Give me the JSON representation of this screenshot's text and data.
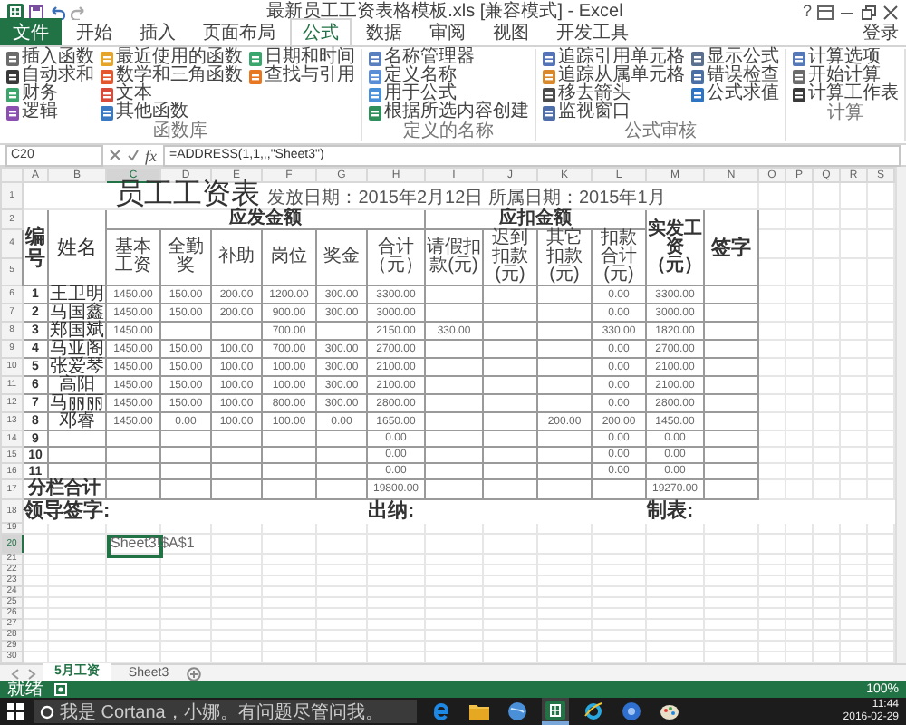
{
  "window": {
    "title": "最新员工工资表格模板.xls [兼容模式] - Excel",
    "help": "?",
    "sign_in": "登录"
  },
  "ribbon_tabs": [
    {
      "label": "文件",
      "kind": "file",
      "selected": false
    },
    {
      "label": "开始",
      "kind": "tab",
      "selected": false
    },
    {
      "label": "插入",
      "kind": "tab",
      "selected": false
    },
    {
      "label": "页面布局",
      "kind": "tab",
      "selected": false
    },
    {
      "label": "公式",
      "kind": "tab",
      "selected": true
    },
    {
      "label": "数据",
      "kind": "tab",
      "selected": false
    },
    {
      "label": "审阅",
      "kind": "tab",
      "selected": false
    },
    {
      "label": "视图",
      "kind": "tab",
      "selected": false
    },
    {
      "label": "开发工具",
      "kind": "tab",
      "selected": false
    }
  ],
  "ribbon_groups": [
    {
      "label": "函数库",
      "columns": [
        [
          "插入函数",
          "自动求和",
          "财务",
          "逻辑"
        ],
        [
          "最近使用的函数",
          "数学和三角函数",
          "文本",
          "其他函数"
        ],
        [
          "日期和时间",
          "查找与引用"
        ]
      ]
    },
    {
      "label": "定义的名称",
      "columns": [
        [
          "名称管理器",
          "定义名称",
          "用于公式",
          "根据所选内容创建"
        ]
      ]
    },
    {
      "label": "公式审核",
      "columns": [
        [
          "追踪引用单元格",
          "追踪从属单元格",
          "移去箭头",
          "监视窗口"
        ],
        [
          "显示公式",
          "错误检查",
          "公式求值"
        ]
      ]
    },
    {
      "label": "计算",
      "columns": [
        [
          "计算选项",
          "开始计算",
          "计算工作表"
        ]
      ]
    }
  ],
  "formula_bar": {
    "name_box": "C20",
    "fx": "fx",
    "formula": "=ADDRESS(1,1,,,\"Sheet3\")"
  },
  "column_headers": [
    {
      "label": "A",
      "selected": false
    },
    {
      "label": "B",
      "selected": false
    },
    {
      "label": "C",
      "selected": true
    },
    {
      "label": "D",
      "selected": false
    },
    {
      "label": "E",
      "selected": false
    },
    {
      "label": "F",
      "selected": false
    },
    {
      "label": "G",
      "selected": false
    },
    {
      "label": "H",
      "selected": false
    },
    {
      "label": "I",
      "selected": false
    },
    {
      "label": "J",
      "selected": false
    },
    {
      "label": "K",
      "selected": false
    },
    {
      "label": "L",
      "selected": false
    },
    {
      "label": "M",
      "selected": false
    },
    {
      "label": "N",
      "selected": false
    },
    {
      "label": "O",
      "selected": false
    },
    {
      "label": "P",
      "selected": false
    },
    {
      "label": "Q",
      "selected": false
    },
    {
      "label": "R",
      "selected": false
    },
    {
      "label": "S",
      "selected": false
    }
  ],
  "row_headers": [
    {
      "label": "1",
      "selected": false
    },
    {
      "label": "2",
      "selected": false
    },
    {
      "label": "4",
      "selected": false
    },
    {
      "label": "5",
      "selected": false
    },
    {
      "label": "6",
      "selected": false
    },
    {
      "label": "7",
      "selected": false
    },
    {
      "label": "8",
      "selected": false
    },
    {
      "label": "9",
      "selected": false
    },
    {
      "label": "10",
      "selected": false
    },
    {
      "label": "11",
      "selected": false
    },
    {
      "label": "12",
      "selected": false
    },
    {
      "label": "13",
      "selected": false
    },
    {
      "label": "14",
      "selected": false
    },
    {
      "label": "15",
      "selected": false
    },
    {
      "label": "16",
      "selected": false
    },
    {
      "label": "17",
      "selected": false
    },
    {
      "label": "18",
      "selected": false
    },
    {
      "label": "19",
      "selected": false
    },
    {
      "label": "20",
      "selected": true
    },
    {
      "label": "21",
      "selected": false
    },
    {
      "label": "22",
      "selected": false
    },
    {
      "label": "23",
      "selected": false
    },
    {
      "label": "24",
      "selected": false
    },
    {
      "label": "25",
      "selected": false
    },
    {
      "label": "26",
      "selected": false
    },
    {
      "label": "27",
      "selected": false
    },
    {
      "label": "28",
      "selected": false
    },
    {
      "label": "29",
      "selected": false
    },
    {
      "label": "30",
      "selected": false
    }
  ],
  "sheet": {
    "title": "员工工资表",
    "date_info": "发放日期：2015年2月12日 所属日期：2015年1月",
    "header": {
      "number": "编号",
      "name": "姓名",
      "gross_group": "应发金额",
      "gross_columns": [
        "基本工资",
        "全勤奖",
        "补助",
        "岗位",
        "奖金",
        "合计（元）"
      ],
      "deduction_group": "应扣金额",
      "deduction_columns": [
        "请假扣款(元)",
        "迟到扣款(元)",
        "其它扣款(元)",
        "扣款合计(元)"
      ],
      "net": "实发工资（元）",
      "signature": "签字"
    },
    "employees": [
      {
        "no": "1",
        "name": "王卫明",
        "base": "1450.00",
        "attendance": "150.00",
        "allowance": "200.00",
        "post": "1200.00",
        "bonus": "300.00",
        "gross": "3300.00",
        "deduction": "0.00",
        "net": "3300.00"
      },
      {
        "no": "2",
        "name": "马国鑫",
        "base": "1450.00",
        "attendance": "150.00",
        "allowance": "200.00",
        "post": "900.00",
        "bonus": "300.00",
        "gross": "3000.00",
        "deduction": "0.00",
        "net": "3000.00"
      },
      {
        "no": "3",
        "name": "郑国斌",
        "base": "1450.00",
        "post": "700.00",
        "gross": "2150.00",
        "leave": "330.00",
        "deduction": "330.00",
        "net": "1820.00"
      },
      {
        "no": "4",
        "name": "马亚阁",
        "base": "1450.00",
        "attendance": "150.00",
        "allowance": "100.00",
        "post": "700.00",
        "bonus": "300.00",
        "gross": "2700.00",
        "deduction": "0.00",
        "net": "2700.00"
      },
      {
        "no": "5",
        "name": "张爱琴",
        "base": "1450.00",
        "attendance": "150.00",
        "allowance": "100.00",
        "post": "100.00",
        "bonus": "300.00",
        "gross": "2100.00",
        "deduction": "0.00",
        "net": "2100.00"
      },
      {
        "no": "6",
        "name": "高阳",
        "base": "1450.00",
        "attendance": "150.00",
        "allowance": "100.00",
        "post": "100.00",
        "bonus": "300.00",
        "gross": "2100.00",
        "deduction": "0.00",
        "net": "2100.00"
      },
      {
        "no": "7",
        "name": "马丽丽",
        "base": "1450.00",
        "attendance": "150.00",
        "allowance": "100.00",
        "post": "800.00",
        "bonus": "300.00",
        "gross": "2800.00",
        "deduction": "0.00",
        "net": "2800.00"
      },
      {
        "no": "8",
        "name": "邓睿",
        "base": "1450.00",
        "attendance": "0.00",
        "allowance": "100.00",
        "post": "100.00",
        "bonus": "0.00",
        "gross": "1650.00",
        "other": "200.00",
        "deduction": "200.00",
        "net": "1450.00"
      },
      {
        "no": "9",
        "gross": "0.00",
        "deduction": "0.00",
        "net": "0.00"
      },
      {
        "no": "10",
        "gross": "0.00",
        "deduction": "0.00",
        "net": "0.00"
      },
      {
        "no": "11",
        "gross": "0.00",
        "deduction": "0.00",
        "net": "0.00"
      }
    ],
    "total": {
      "label": "分栏合计",
      "gross": "19800.00",
      "net": "19270.00"
    },
    "signatures": [
      "领导签字:",
      "出纳:",
      "制表:"
    ],
    "active_cell": {
      "value": "Sheet3!$A$1"
    }
  },
  "sheet_tabs": [
    {
      "label": "5月工资",
      "selected": true
    },
    {
      "label": "Sheet3",
      "selected": false
    }
  ],
  "status_bar": {
    "status": "就绪",
    "zoom": "100%"
  },
  "taskbar": {
    "search_placeholder": "我是 Cortana，小娜。有问题尽管问我。",
    "time": "11:44",
    "date": "2016-02-29"
  }
}
